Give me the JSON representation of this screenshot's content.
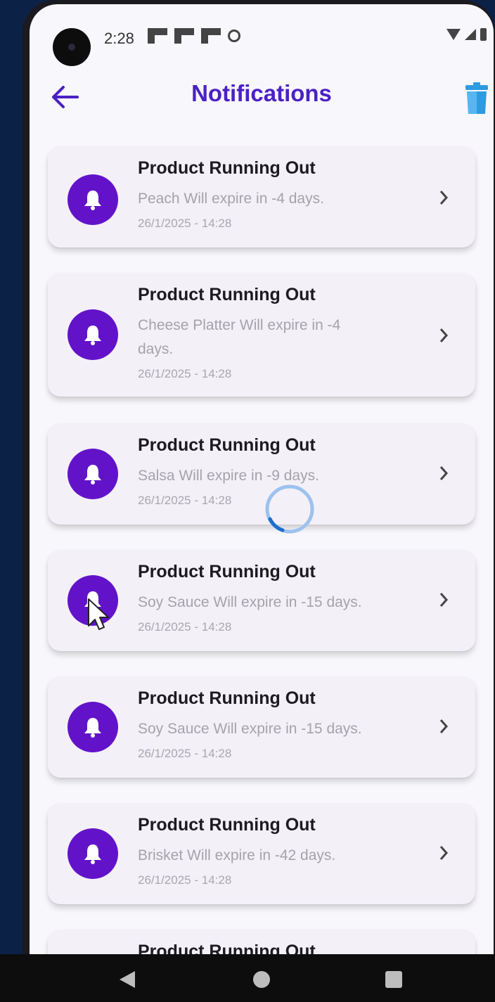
{
  "status_bar": {
    "time": "2:28"
  },
  "header": {
    "title": "Notifications",
    "back_icon": "arrow-left-icon",
    "delete_icon": "trash-icon"
  },
  "colors": {
    "accent": "#4b21c4",
    "avatar_bg": "#6213c9",
    "trash": "#2e9be0",
    "card_bg": "#f4f0f8"
  },
  "notifications": [
    {
      "title": "Product Running Out",
      "message": "Peach Will expire in -4 days.",
      "date": "26/1/2025 - 14:28"
    },
    {
      "title": "Product Running Out",
      "message": "Cheese Platter Will expire in -4 days.",
      "date": "26/1/2025 - 14:28"
    },
    {
      "title": "Product Running Out",
      "message": "Salsa Will expire in -9 days.",
      "date": "26/1/2025 - 14:28"
    },
    {
      "title": "Product Running Out",
      "message": "Soy Sauce Will expire in -15 days.",
      "date": "26/1/2025 - 14:28"
    },
    {
      "title": "Product Running Out",
      "message": "Soy Sauce Will expire in -15 days.",
      "date": "26/1/2025 - 14:28"
    },
    {
      "title": "Product Running Out",
      "message": "Brisket Will expire in -42 days.",
      "date": "26/1/2025 - 14:28"
    },
    {
      "title": "Product Running Out",
      "message": "",
      "date": ""
    }
  ],
  "nav_bar": {
    "back": "nav-back-icon",
    "home": "nav-home-icon",
    "recents": "nav-recents-icon"
  }
}
